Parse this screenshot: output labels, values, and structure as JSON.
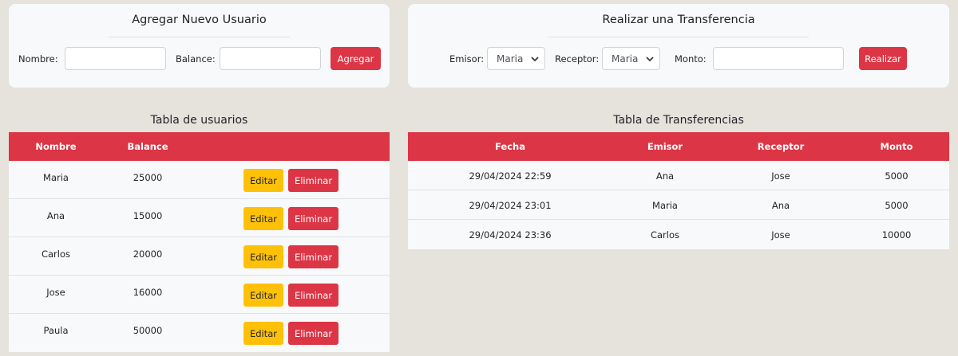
{
  "add_user": {
    "title": "Agregar Nuevo Usuario",
    "name_label": "Nombre:",
    "name_value": "",
    "balance_label": "Balance:",
    "balance_value": "",
    "submit_label": "Agregar"
  },
  "transfer": {
    "title": "Realizar una Transferencia",
    "sender_label": "Emisor:",
    "sender_value": "Maria",
    "receiver_label": "Receptor:",
    "receiver_value": "Maria",
    "amount_label": "Monto:",
    "amount_value": "",
    "submit_label": "Realizar"
  },
  "users_table": {
    "title": "Tabla de usuarios",
    "headers": [
      "Nombre",
      "Balance"
    ],
    "edit_label": "Editar",
    "delete_label": "Eliminar",
    "rows": [
      {
        "name": "Maria",
        "balance": "25000"
      },
      {
        "name": "Ana",
        "balance": "15000"
      },
      {
        "name": "Carlos",
        "balance": "20000"
      },
      {
        "name": "Jose",
        "balance": "16000"
      },
      {
        "name": "Paula",
        "balance": "50000"
      }
    ]
  },
  "transfers_table": {
    "title": "Tabla de Transferencias",
    "headers": [
      "Fecha",
      "Emisor",
      "Receptor",
      "Monto"
    ],
    "rows": [
      {
        "date": "29/04/2024 22:59",
        "sender": "Ana",
        "receiver": "Jose",
        "amount": "5000"
      },
      {
        "date": "29/04/2024 23:01",
        "sender": "Maria",
        "receiver": "Ana",
        "amount": "5000"
      },
      {
        "date": "29/04/2024 23:36",
        "sender": "Carlos",
        "receiver": "Jose",
        "amount": "10000"
      }
    ]
  },
  "colors": {
    "accent_red": "#dc3545",
    "edit_yellow": "#ffc107",
    "page_bg": "#e6e2dc",
    "card_bg": "#f8f9fa"
  }
}
